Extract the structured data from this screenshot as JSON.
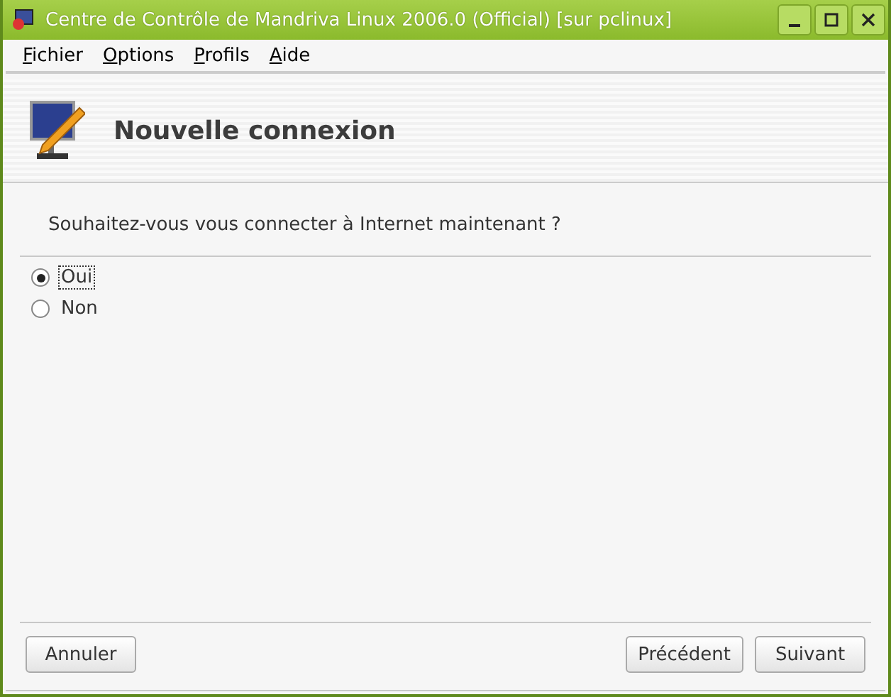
{
  "window": {
    "title": "Centre de Contrôle de Mandriva Linux 2006.0 (Official) [sur pclinux]"
  },
  "menu": [
    "Fichier",
    "Options",
    "Profils",
    "Aide"
  ],
  "header": {
    "title": "Nouvelle connexion"
  },
  "question": "Souhaitez-vous vous connecter à Internet maintenant ?",
  "options": [
    {
      "label": "Oui",
      "selected": true
    },
    {
      "label": "Non",
      "selected": false
    }
  ],
  "buttons": {
    "left": [
      "Annuler"
    ],
    "right": [
      "Précédent",
      "Suivant"
    ]
  }
}
